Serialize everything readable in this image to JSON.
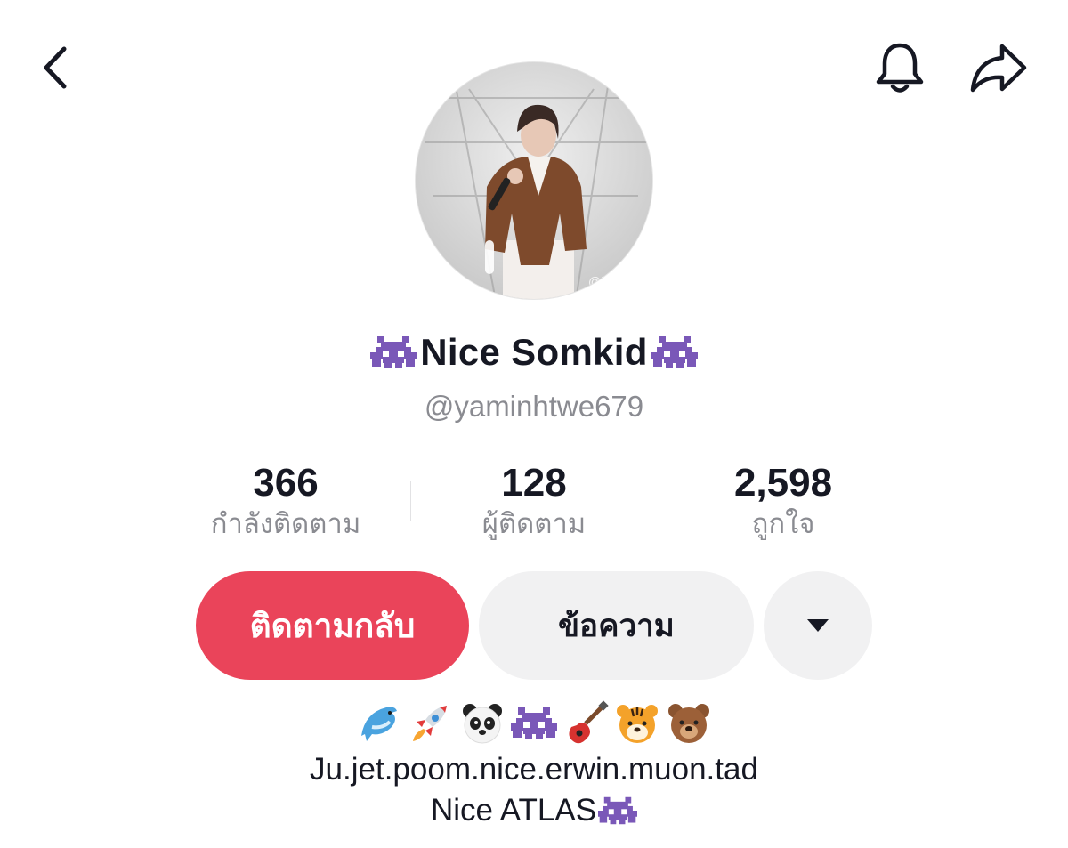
{
  "header": {
    "back_icon": "chevron-left-icon",
    "bell_icon": "bell-icon",
    "share_icon": "share-arrow-icon"
  },
  "profile": {
    "avatar_watermark": "@b",
    "name_prefix_icon": "alien-monster-icon",
    "display_name": "Nice Somkid",
    "name_suffix_icon": "alien-monster-icon",
    "username": "@yaminhtwe679"
  },
  "stats": {
    "following_value": "366",
    "following_label": "กำลังติดตาม",
    "followers_value": "128",
    "followers_label": "ผู้ติดตาม",
    "likes_value": "2,598",
    "likes_label": "ถูกใจ"
  },
  "actions": {
    "follow_back_label": "ติดตามกลับ",
    "message_label": "ข้อความ",
    "more_icon": "caret-down-icon"
  },
  "bio": {
    "emojis": [
      "dolphin-icon",
      "rocket-icon",
      "panda-icon",
      "alien-monster-icon",
      "guitar-icon",
      "tiger-icon",
      "bear-icon"
    ],
    "line1": "Ju.jet.poom.nice.erwin.muon.tad",
    "line2": "Nice ATLAS",
    "line2_suffix_icon": "alien-monster-icon"
  },
  "colors": {
    "primary_button": "#ea445a",
    "secondary_button": "#f1f1f2",
    "text_primary": "#161823",
    "text_secondary": "#8a8b91",
    "alien_purple": "#7a58b8"
  }
}
